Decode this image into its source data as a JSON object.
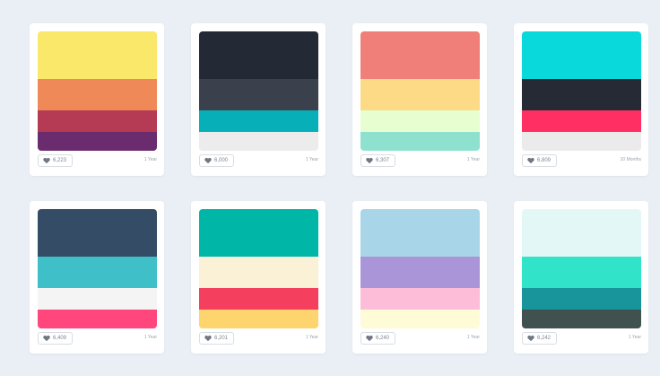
{
  "palettes": [
    {
      "colors": [
        "#f9e86a",
        "#ef8a58",
        "#b53a54",
        "#6b2b6f"
      ],
      "likes": "6,223",
      "age": "1 Year"
    },
    {
      "colors": [
        "#232a35",
        "#3a414d",
        "#07afb8",
        "#ececec"
      ],
      "likes": "6,000",
      "age": "1 Year"
    },
    {
      "colors": [
        "#ef7f78",
        "#fddb86",
        "#e7ffd0",
        "#8fe1cf"
      ],
      "likes": "6,307",
      "age": "1 Year"
    },
    {
      "colors": [
        "#09d9da",
        "#252a35",
        "#ff2e63",
        "#ebebeb"
      ],
      "likes": "6,809",
      "age": "10 Months"
    },
    {
      "colors": [
        "#354c67",
        "#3fc0c9",
        "#f4f4f4",
        "#ff467d"
      ],
      "likes": "6,409",
      "age": "1 Year"
    },
    {
      "colors": [
        "#00b7a7",
        "#faf1d6",
        "#f43f5e",
        "#fed46f"
      ],
      "likes": "6,201",
      "age": "1 Year"
    },
    {
      "colors": [
        "#a8d6e8",
        "#aa95d8",
        "#fdbcd8",
        "#fefcd7"
      ],
      "likes": "6,240",
      "age": "1 Year"
    },
    {
      "colors": [
        "#e3f8f6",
        "#30e3c9",
        "#17959b",
        "#41514f"
      ],
      "likes": "6,242",
      "age": "1 Year"
    }
  ]
}
